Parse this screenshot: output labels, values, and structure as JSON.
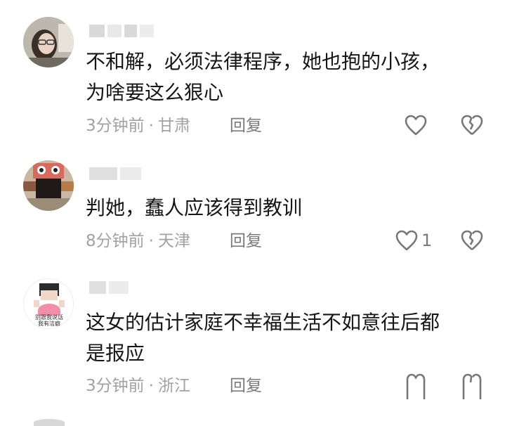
{
  "comments": [
    {
      "text_lines": [
        "不和解，必须法律程序，她也抱的小孩，",
        "为啥要这么狠心"
      ],
      "time": "3分钟前",
      "location": "甘肃",
      "reply_label": "回复",
      "likes": ""
    },
    {
      "text_lines": [
        "判她，蠢人应该得到教训"
      ],
      "time": "8分钟前",
      "location": "天津",
      "reply_label": "回复",
      "likes": "1"
    },
    {
      "text_lines": [
        "这女的估计家庭不幸福生活不如意往后都",
        "是报应"
      ],
      "time": "3分钟前",
      "location": "浙江",
      "reply_label": "回复",
      "likes": "",
      "avatar_caption": [
        "别跟我说话",
        "我有洁癖"
      ]
    }
  ],
  "separator_dot": "·",
  "icons": {
    "like": "heart-outline-icon",
    "dislike": "broken-heart-icon"
  }
}
